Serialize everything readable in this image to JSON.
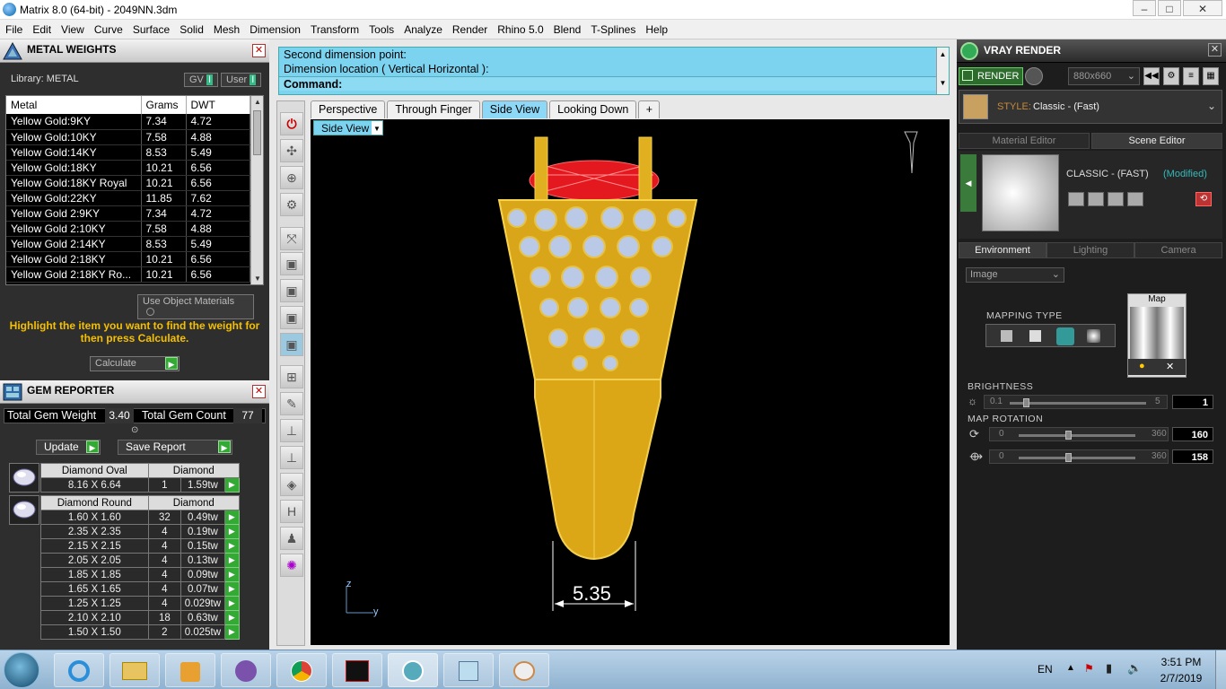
{
  "window": {
    "title": "Matrix 8.0 (64-bit) - 2049NN.3dm"
  },
  "menu": [
    "File",
    "Edit",
    "View",
    "Curve",
    "Surface",
    "Solid",
    "Mesh",
    "Dimension",
    "Transform",
    "Tools",
    "Analyze",
    "Render",
    "Rhino 5.0",
    "Blend",
    "T-Splines",
    "Help"
  ],
  "metal_weights": {
    "title": "METAL WEIGHTS",
    "library": "Library: METAL",
    "gv": "GV",
    "user": "User",
    "columns": [
      "Metal",
      "Grams",
      "DWT"
    ],
    "rows": [
      [
        "Yellow Gold:9KY",
        "7.34",
        "4.72"
      ],
      [
        "Yellow Gold:10KY",
        "7.58",
        "4.88"
      ],
      [
        "Yellow Gold:14KY",
        "8.53",
        "5.49"
      ],
      [
        "Yellow Gold:18KY",
        "10.21",
        "6.56"
      ],
      [
        "Yellow Gold:18KY Royal",
        "10.21",
        "6.56"
      ],
      [
        "Yellow Gold:22KY",
        "11.85",
        "7.62"
      ],
      [
        "Yellow Gold 2:9KY",
        "7.34",
        "4.72"
      ],
      [
        "Yellow Gold 2:10KY",
        "7.58",
        "4.88"
      ],
      [
        "Yellow Gold 2:14KY",
        "8.53",
        "5.49"
      ],
      [
        "Yellow Gold 2:18KY",
        "10.21",
        "6.56"
      ],
      [
        "Yellow Gold 2:18KY Ro...",
        "10.21",
        "6.56"
      ]
    ],
    "use_object_materials": "Use Object Materials",
    "hint": "Highlight the item you want to find the weight for then press Calculate.",
    "calculate": "Calculate"
  },
  "gem_reporter": {
    "title": "GEM REPORTER",
    "total_weight_label": "Total Gem Weight",
    "total_weight": "3.40",
    "total_count_label": "Total Gem Count",
    "total_count": "77",
    "update": "Update",
    "save_report": "Save Report",
    "groups": [
      {
        "shape": "Diamond Oval",
        "material": "Diamond",
        "rows": [
          [
            "8.16 X 6.64",
            "1",
            "1.59tw"
          ]
        ]
      },
      {
        "shape": "Diamond Round",
        "material": "Diamond",
        "rows": [
          [
            "1.60 X 1.60",
            "32",
            "0.49tw"
          ],
          [
            "2.35 X 2.35",
            "4",
            "0.19tw"
          ],
          [
            "2.15 X 2.15",
            "4",
            "0.15tw"
          ],
          [
            "2.05 X 2.05",
            "4",
            "0.13tw"
          ],
          [
            "1.85 X 1.85",
            "4",
            "0.09tw"
          ],
          [
            "1.65 X 1.65",
            "4",
            "0.07tw"
          ],
          [
            "1.25 X 1.25",
            "4",
            "0.029tw"
          ],
          [
            "2.10 X 2.10",
            "18",
            "0.63tw"
          ],
          [
            "1.50 X 1.50",
            "2",
            "0.025tw"
          ]
        ]
      }
    ]
  },
  "command": {
    "line1": "Second dimension point:",
    "line2": "Dimension location ( Vertical  Horizontal ):",
    "prompt": "Command:"
  },
  "viewport": {
    "tabs": [
      "Perspective",
      "Through Finger",
      "Side View",
      "Looking Down"
    ],
    "active_tab": "Side View",
    "label": "Side View",
    "dimension": "5.35",
    "axis_z": "z",
    "axis_y": "y"
  },
  "vray": {
    "title": "VRAY RENDER",
    "render": "RENDER",
    "resolution": "880x660",
    "style_label": "STYLE:",
    "style_value": "Classic - (Fast)",
    "tabs": [
      "Material Editor",
      "Scene Editor"
    ],
    "preset_name": "CLASSIC - (FAST)",
    "preset_state": "(Modified)",
    "env_tabs": [
      "Environment",
      "Lighting",
      "Camera"
    ],
    "env_source": "Image",
    "mapping_type": "MAPPING TYPE",
    "map_label": "Map",
    "brightness": {
      "label": "BRIGHTNESS",
      "min": "0.1",
      "max": "5",
      "value": "1",
      "level": 0.1
    },
    "map_rotation": {
      "label": "MAP ROTATION",
      "r1": {
        "min": "0",
        "max": "360",
        "value": "160"
      },
      "r2": {
        "min": "0",
        "max": "360",
        "value": "158"
      }
    }
  },
  "taskbar": {
    "lang": "EN",
    "time": "3:51 PM",
    "date": "2/7/2019"
  }
}
